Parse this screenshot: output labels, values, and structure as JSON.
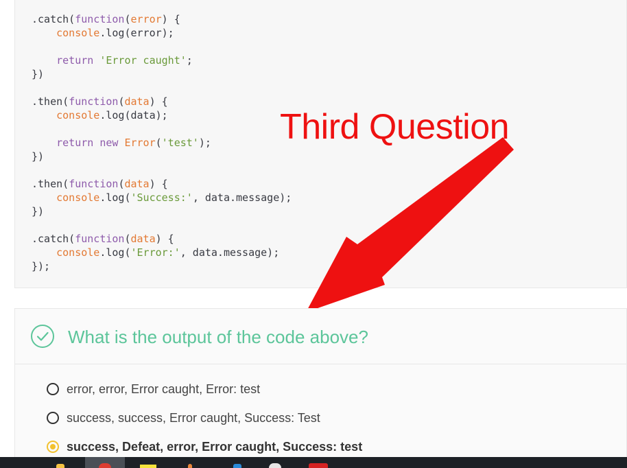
{
  "code_lines": [
    [
      {
        "t": ".catch(",
        "c": ""
      },
      {
        "t": "function",
        "c": "kw"
      },
      {
        "t": "(",
        "c": ""
      },
      {
        "t": "error",
        "c": "var"
      },
      {
        "t": ") {",
        "c": ""
      }
    ],
    [
      {
        "t": "    ",
        "c": ""
      },
      {
        "t": "console",
        "c": "var"
      },
      {
        "t": ".log(error);",
        "c": ""
      }
    ],
    [],
    [
      {
        "t": "    ",
        "c": ""
      },
      {
        "t": "return",
        "c": "kw"
      },
      {
        "t": " ",
        "c": ""
      },
      {
        "t": "'Error caught'",
        "c": "str"
      },
      {
        "t": ";",
        "c": ""
      }
    ],
    [
      {
        "t": "})",
        "c": ""
      }
    ],
    [],
    [
      {
        "t": ".then(",
        "c": ""
      },
      {
        "t": "function",
        "c": "kw"
      },
      {
        "t": "(",
        "c": ""
      },
      {
        "t": "data",
        "c": "var"
      },
      {
        "t": ") {",
        "c": ""
      }
    ],
    [
      {
        "t": "    ",
        "c": ""
      },
      {
        "t": "console",
        "c": "var"
      },
      {
        "t": ".log(data);",
        "c": ""
      }
    ],
    [],
    [
      {
        "t": "    ",
        "c": ""
      },
      {
        "t": "return",
        "c": "kw"
      },
      {
        "t": " ",
        "c": ""
      },
      {
        "t": "new",
        "c": "kw"
      },
      {
        "t": " ",
        "c": ""
      },
      {
        "t": "Error",
        "c": "var"
      },
      {
        "t": "(",
        "c": ""
      },
      {
        "t": "'test'",
        "c": "str"
      },
      {
        "t": ");",
        "c": ""
      }
    ],
    [
      {
        "t": "})",
        "c": ""
      }
    ],
    [],
    [
      {
        "t": ".then(",
        "c": ""
      },
      {
        "t": "function",
        "c": "kw"
      },
      {
        "t": "(",
        "c": ""
      },
      {
        "t": "data",
        "c": "var"
      },
      {
        "t": ") {",
        "c": ""
      }
    ],
    [
      {
        "t": "    ",
        "c": ""
      },
      {
        "t": "console",
        "c": "var"
      },
      {
        "t": ".log(",
        "c": ""
      },
      {
        "t": "'Success:'",
        "c": "str"
      },
      {
        "t": ", data.message);",
        "c": ""
      }
    ],
    [
      {
        "t": "})",
        "c": ""
      }
    ],
    [],
    [
      {
        "t": ".catch(",
        "c": ""
      },
      {
        "t": "function",
        "c": "kw"
      },
      {
        "t": "(",
        "c": ""
      },
      {
        "t": "data",
        "c": "var"
      },
      {
        "t": ") {",
        "c": ""
      }
    ],
    [
      {
        "t": "    ",
        "c": ""
      },
      {
        "t": "console",
        "c": "var"
      },
      {
        "t": ".log(",
        "c": ""
      },
      {
        "t": "'Error:'",
        "c": "str"
      },
      {
        "t": ", data.message);",
        "c": ""
      }
    ],
    [
      {
        "t": "});",
        "c": ""
      }
    ]
  ],
  "annotation": {
    "text": "Third Question",
    "color": "#ee1111"
  },
  "question": {
    "title": "What is the output of the code above?",
    "icon": "check-circle-icon",
    "accent_color": "#5cc59a",
    "options": [
      {
        "label": "error, error, Error caught, Error: test",
        "selected": false
      },
      {
        "label": "success, success, Error caught, Success: Test",
        "selected": false
      },
      {
        "label": "success, Defeat, error, Error caught, Success: test",
        "selected": true
      }
    ]
  },
  "taskbar": {
    "icons": [
      "file-explorer-icon",
      "chrome-icon",
      "sticky-notes-icon",
      "app-icon",
      "vscode-icon",
      "app-icon-2",
      "app-icon-3"
    ]
  }
}
